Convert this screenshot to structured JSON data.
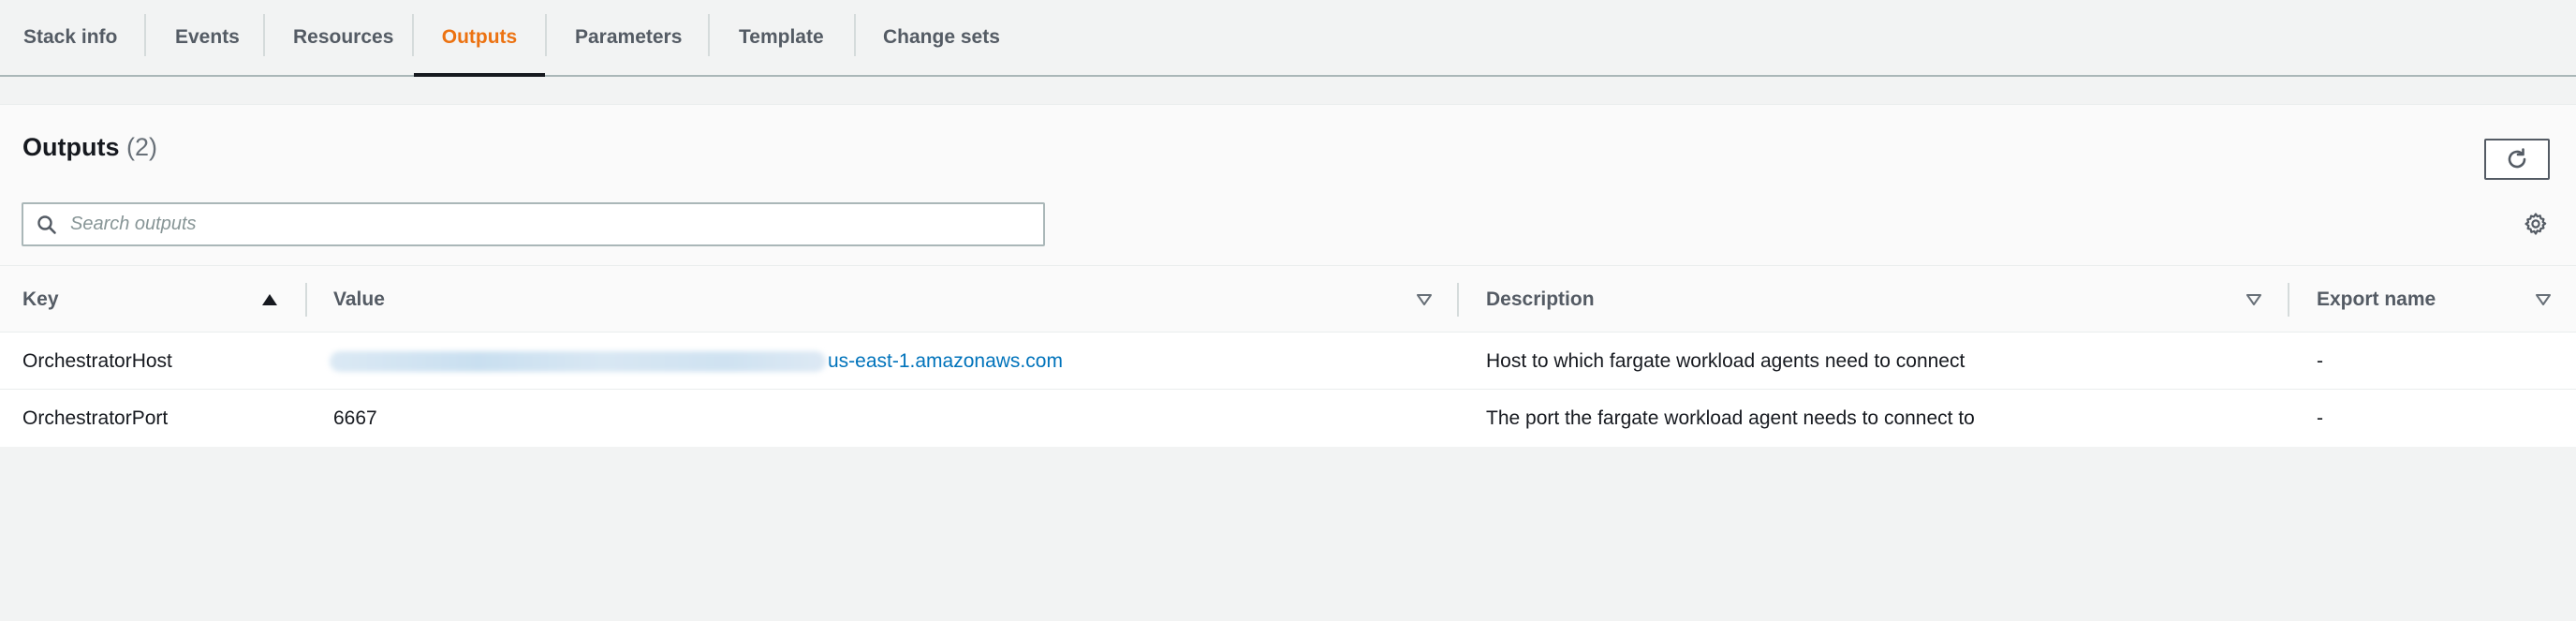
{
  "tabs": [
    {
      "label": "Stack info"
    },
    {
      "label": "Events"
    },
    {
      "label": "Resources"
    },
    {
      "label": "Outputs",
      "active": true
    },
    {
      "label": "Parameters"
    },
    {
      "label": "Template"
    },
    {
      "label": "Change sets"
    }
  ],
  "panel": {
    "title": "Outputs",
    "count": "(2)",
    "refresh_icon": "refresh-icon",
    "settings_icon": "gear-icon"
  },
  "search": {
    "placeholder": "Search outputs",
    "value": ""
  },
  "table": {
    "columns": [
      "Key",
      "Value",
      "Description",
      "Export name"
    ],
    "sort": {
      "column": "Key",
      "direction": "ascending"
    },
    "rows": [
      {
        "key": "OrchestratorHost",
        "value_visible": "us-east-1.amazonaws.com",
        "value_redacted": true,
        "description": "Host to which fargate workload agents need to connect",
        "export_name": "-"
      },
      {
        "key": "OrchestratorPort",
        "value_visible": "6667",
        "value_redacted": false,
        "description": "The port the fargate workload agent needs to connect to",
        "export_name": "-"
      }
    ]
  },
  "colors": {
    "accent": "#ec7211",
    "link": "#0073bb",
    "text": "#16191f",
    "muted": "#545b64"
  }
}
